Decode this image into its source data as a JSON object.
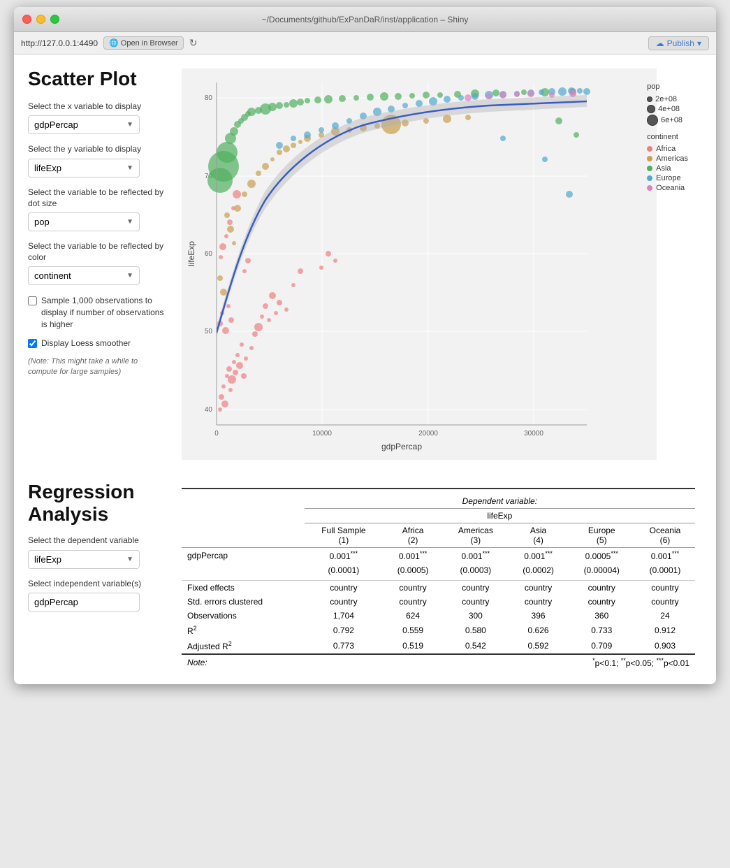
{
  "window": {
    "title": "~/Documents/github/ExPanDaR/inst/application – Shiny"
  },
  "addressbar": {
    "url": "http://127.0.0.1:4490",
    "open_browser_label": "Open in Browser",
    "publish_label": "Publish"
  },
  "scatter": {
    "section_title": "Scatter Plot",
    "x_label": "Select the x variable to display",
    "x_value": "gdpPercap",
    "y_label": "Select the y variable to display",
    "y_value": "lifeExp",
    "size_label": "Select the variable to be reflected by dot size",
    "size_value": "pop",
    "color_label": "Select the variable to be reflected by color",
    "color_value": "continent",
    "checkbox1_label": "Sample 1,000 observations to display if number of observations is higher",
    "checkbox1_checked": false,
    "checkbox2_label": "Display Loess smoother",
    "checkbox2_checked": true,
    "note": "(Note: This might take a while to compute for large samples)",
    "x_axis_label": "gdpPercap",
    "y_axis_label": "lifeExp",
    "x_ticks": [
      "0",
      "10000",
      "20000",
      "30000"
    ],
    "y_ticks": [
      "40",
      "50",
      "60",
      "70",
      "80"
    ],
    "legend_pop_title": "pop",
    "legend_pop_items": [
      {
        "label": "2e+08",
        "size": 8
      },
      {
        "label": "4e+08",
        "size": 12
      },
      {
        "label": "6e+08",
        "size": 16
      }
    ],
    "legend_continent_title": "continent",
    "legend_continent_items": [
      {
        "label": "Africa",
        "color": "#f08080"
      },
      {
        "label": "Americas",
        "color": "#c8a050"
      },
      {
        "label": "Asia",
        "color": "#50b060"
      },
      {
        "label": "Europe",
        "color": "#50a8d0"
      },
      {
        "label": "Oceania",
        "color": "#e080c0"
      }
    ]
  },
  "regression": {
    "section_title": "Regression Analysis",
    "dep_label": "Select the dependent variable",
    "dep_value": "lifeExp",
    "indep_label": "Select independent variable(s)",
    "indep_value": "gdpPercap",
    "table": {
      "dep_var_label": "Dependent variable:",
      "dep_var_name": "lifeExp",
      "columns": [
        "",
        "Full Sample (1)",
        "Africa (2)",
        "Americas (3)",
        "Asia (4)",
        "Europe (5)",
        "Oceania (6)"
      ],
      "rows": [
        {
          "name": "gdpPercap",
          "values": [
            "0.001***",
            "0.001***",
            "0.001***",
            "0.001***",
            "0.0005***",
            "0.001***"
          ],
          "se": [
            "(0.0001)",
            "(0.0005)",
            "(0.0003)",
            "(0.0002)",
            "(0.00004)",
            "(0.0001)"
          ]
        }
      ],
      "fixed_effects_label": "Fixed effects",
      "fixed_effects_values": [
        "country",
        "country",
        "country",
        "country",
        "country",
        "country"
      ],
      "std_errors_label": "Std. errors clustered",
      "std_errors_values": [
        "country",
        "country",
        "country",
        "country",
        "country",
        "country"
      ],
      "observations_label": "Observations",
      "observations_values": [
        "1,704",
        "624",
        "300",
        "396",
        "360",
        "24"
      ],
      "r2_label": "R²",
      "r2_values": [
        "0.792",
        "0.559",
        "0.580",
        "0.626",
        "0.733",
        "0.912"
      ],
      "adj_r2_label": "Adjusted R²",
      "adj_r2_values": [
        "0.773",
        "0.519",
        "0.542",
        "0.592",
        "0.709",
        "0.903"
      ],
      "note_label": "Note:",
      "note_stars": "*p<0.1; **p<0.05; ***p<0.01"
    }
  }
}
